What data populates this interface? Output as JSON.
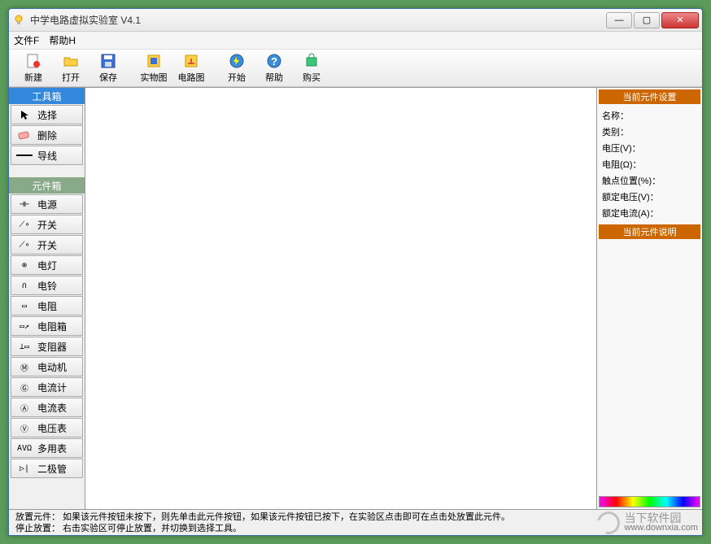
{
  "window": {
    "title": "中学电路虚拟实验室 V4.1"
  },
  "menu": {
    "file": "文件F",
    "help": "帮助H"
  },
  "toolbar": {
    "new": "新建",
    "open": "打开",
    "save": "保存",
    "real": "实物图",
    "circuit": "电路图",
    "start": "开始",
    "help": "帮助",
    "buy": "购买"
  },
  "left": {
    "toolbox_title": "工具箱",
    "tools": [
      {
        "icon": "cursor",
        "label": "选择"
      },
      {
        "icon": "eraser",
        "label": "删除"
      },
      {
        "icon": "wire",
        "label": "导线"
      }
    ],
    "compbox_title": "元件箱",
    "components": [
      {
        "icon": "⊣⊢",
        "label": "电源"
      },
      {
        "icon": "⟋∘",
        "label": "开关"
      },
      {
        "icon": "⟋∘",
        "label": "开关"
      },
      {
        "icon": "⊗",
        "label": "电灯"
      },
      {
        "icon": "∩",
        "label": "电铃"
      },
      {
        "icon": "▭",
        "label": "电阻"
      },
      {
        "icon": "▭↗",
        "label": "电阻箱"
      },
      {
        "icon": "⊥▭",
        "label": "变阻器"
      },
      {
        "icon": "Ⓜ",
        "label": "电动机"
      },
      {
        "icon": "Ⓖ",
        "label": "电流计"
      },
      {
        "icon": "Ⓐ",
        "label": "电流表"
      },
      {
        "icon": "Ⓥ",
        "label": "电压表"
      },
      {
        "icon": "AVΩ",
        "label": "多用表"
      },
      {
        "icon": "▷|",
        "label": "二极管"
      }
    ]
  },
  "right": {
    "settings_title": "当前元件设置",
    "props": {
      "name": "名称：",
      "type": "类别：",
      "voltage": "电压(V)：",
      "resistance": "电阻(Ω)：",
      "contact": "触点位置(%)：",
      "rated_v": "额定电压(V)：",
      "rated_a": "额定电流(A)："
    },
    "desc_title": "当前元件说明"
  },
  "status": {
    "line1": "放置元件：  如果该元件按钮未按下，则先单击此元件按钮，如果该元件按钮已按下，在实验区点击即可在点击处放置此元件。",
    "line2": "停止放置：  右击实验区可停止放置，并切换到选择工具。"
  },
  "watermark": {
    "cn": "当下软件园",
    "url": "www.downxia.com"
  }
}
